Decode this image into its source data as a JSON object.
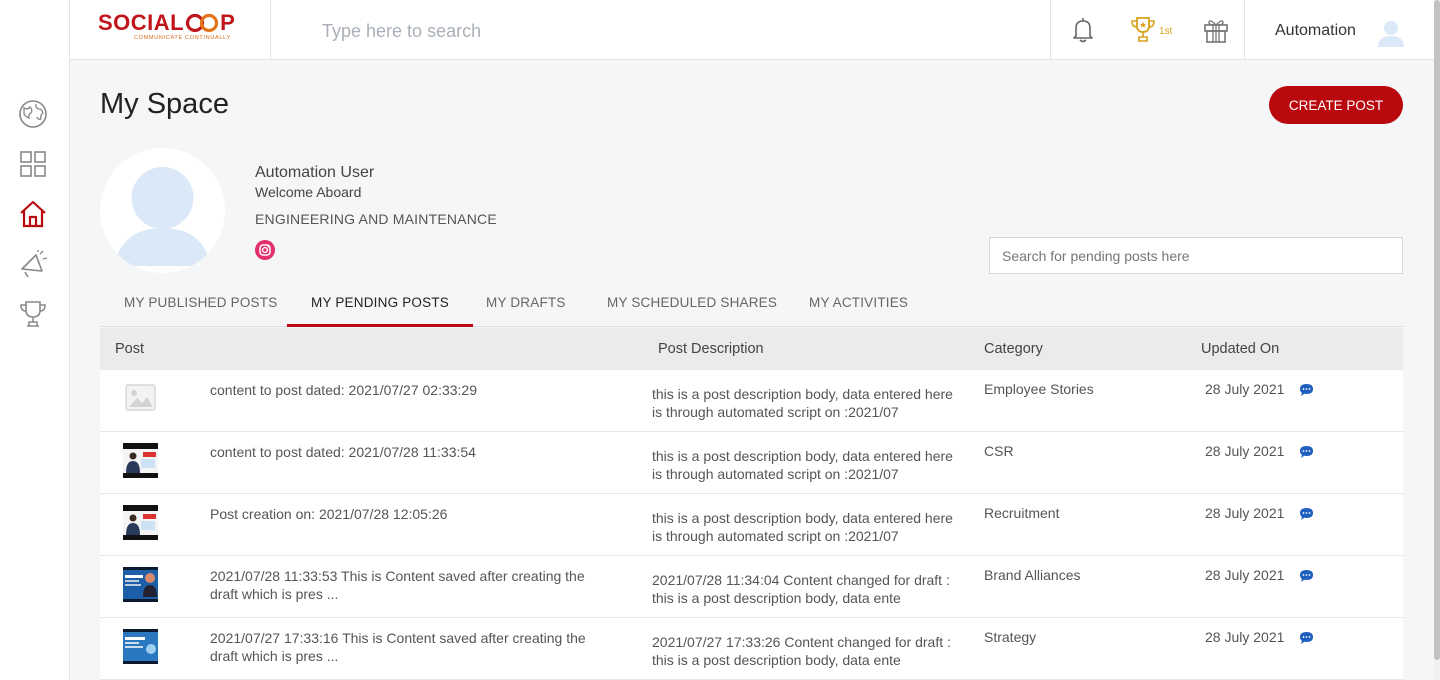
{
  "brand": {
    "logo_text_a": "SOCIAL",
    "logo_text_b": "P",
    "tagline": "COMMUNICATE CONTINUALLY"
  },
  "header": {
    "search_placeholder": "Type here to search",
    "rank": "1st",
    "user_name": "Automation"
  },
  "page": {
    "title": "My Space",
    "create_post_label": "CREATE POST"
  },
  "profile": {
    "name": "Automation User",
    "welcome": "Welcome Aboard",
    "department": "ENGINEERING AND MAINTENANCE"
  },
  "pending_search_placeholder": "Search for pending posts here",
  "tabs": [
    {
      "label": "MY PUBLISHED POSTS"
    },
    {
      "label": "MY PENDING POSTS",
      "active": true
    },
    {
      "label": "MY DRAFTS"
    },
    {
      "label": "MY SCHEDULED SHARES"
    },
    {
      "label": "MY ACTIVITIES"
    }
  ],
  "table": {
    "headers": [
      "Post",
      "Post Description",
      "Category",
      "Updated On"
    ],
    "rows": [
      {
        "thumb": "placeholder-image",
        "post": "content to post dated: 2021/07/27 02:33:29",
        "description": "this is a post description body, data entered here is through automated script on :2021/07",
        "category": "Employee Stories",
        "updated": "28 July 2021"
      },
      {
        "thumb": "video-presenter",
        "post": "content to post dated: 2021/07/28 11:33:54",
        "description": "this is a post description body, data entered here is through automated script on :2021/07",
        "category": "CSR",
        "updated": "28 July 2021"
      },
      {
        "thumb": "video-presenter",
        "post": "Post creation on: 2021/07/28 12:05:26",
        "description": "this is a post description body, data entered here is through automated script on :2021/07",
        "category": "Recruitment",
        "updated": "28 July 2021"
      },
      {
        "thumb": "video-blue-banner",
        "post": "2021/07/28 11:33:53 This is Content saved after creating the draft which is pres ...",
        "description": "2021/07/28 11:34:04 Content changed for draft : this is a post description body, data ente",
        "category": "Brand Alliances",
        "updated": "28 July 2021"
      },
      {
        "thumb": "video-blue-banner",
        "post": "2021/07/27 17:33:16 This is Content saved after creating the draft which is pres ...",
        "description": "2021/07/27 17:33:26 Content changed for draft : this is a post description body, data ente",
        "category": "Strategy",
        "updated": "28 July 2021"
      }
    ]
  },
  "colors": {
    "brand_red": "#b9090f",
    "trophy_gold": "#d9a21b",
    "comment_blue": "#1f5fc0",
    "instagram_pink": "#e1306c"
  },
  "icons": {
    "rail": [
      "globe-icon",
      "grid-icon",
      "home-icon",
      "megaphone-icon",
      "trophy-icon"
    ],
    "header": [
      "bell-icon",
      "trophy-icon",
      "gift-icon",
      "user-avatar-icon"
    ]
  }
}
